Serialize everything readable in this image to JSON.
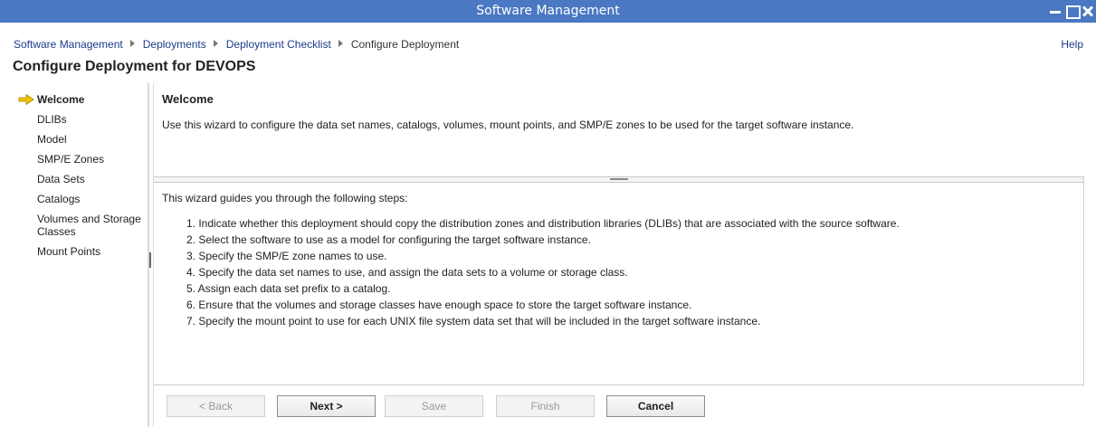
{
  "window": {
    "title": "Software Management"
  },
  "breadcrumb": {
    "items": [
      "Software Management",
      "Deployments",
      "Deployment Checklist"
    ],
    "current": "Configure Deployment"
  },
  "help_label": "Help",
  "page_title": "Configure Deployment for DEVOPS",
  "nav": {
    "items": [
      {
        "label": "Welcome"
      },
      {
        "label": "DLIBs"
      },
      {
        "label": "Model"
      },
      {
        "label": "SMP/E Zones"
      },
      {
        "label": "Data Sets"
      },
      {
        "label": "Catalogs"
      },
      {
        "label": "Volumes and Storage",
        "label2": "Classes"
      },
      {
        "label": "Mount Points"
      }
    ],
    "active_icon": "arrow-right-icon",
    "active_icon_color": "#f2c100"
  },
  "welcome": {
    "title": "Welcome",
    "intro": "Use this wizard to configure the data set names, catalogs, volumes, mount points, and SMP/E zones to be used for the target software instance.",
    "steps_intro": "This wizard guides you through the following steps:",
    "steps": [
      "1. Indicate whether this deployment should copy the distribution zones and distribution libraries (DLIBs) that are associated with the source software.",
      "2. Select the software to use as a model for configuring the target software instance.",
      "3. Specify the SMP/E zone names to use.",
      "4. Specify the data set names to use, and assign the data sets to a volume or storage class.",
      "5. Assign each data set prefix to a catalog.",
      "6. Ensure that the volumes and storage classes have enough space to store the target software instance.",
      "7. Specify the mount point to use for each UNIX file system data set that will be included in the target software instance."
    ]
  },
  "buttons": {
    "back": "< Back",
    "next": "Next >",
    "save": "Save",
    "finish": "Finish",
    "cancel": "Cancel"
  }
}
